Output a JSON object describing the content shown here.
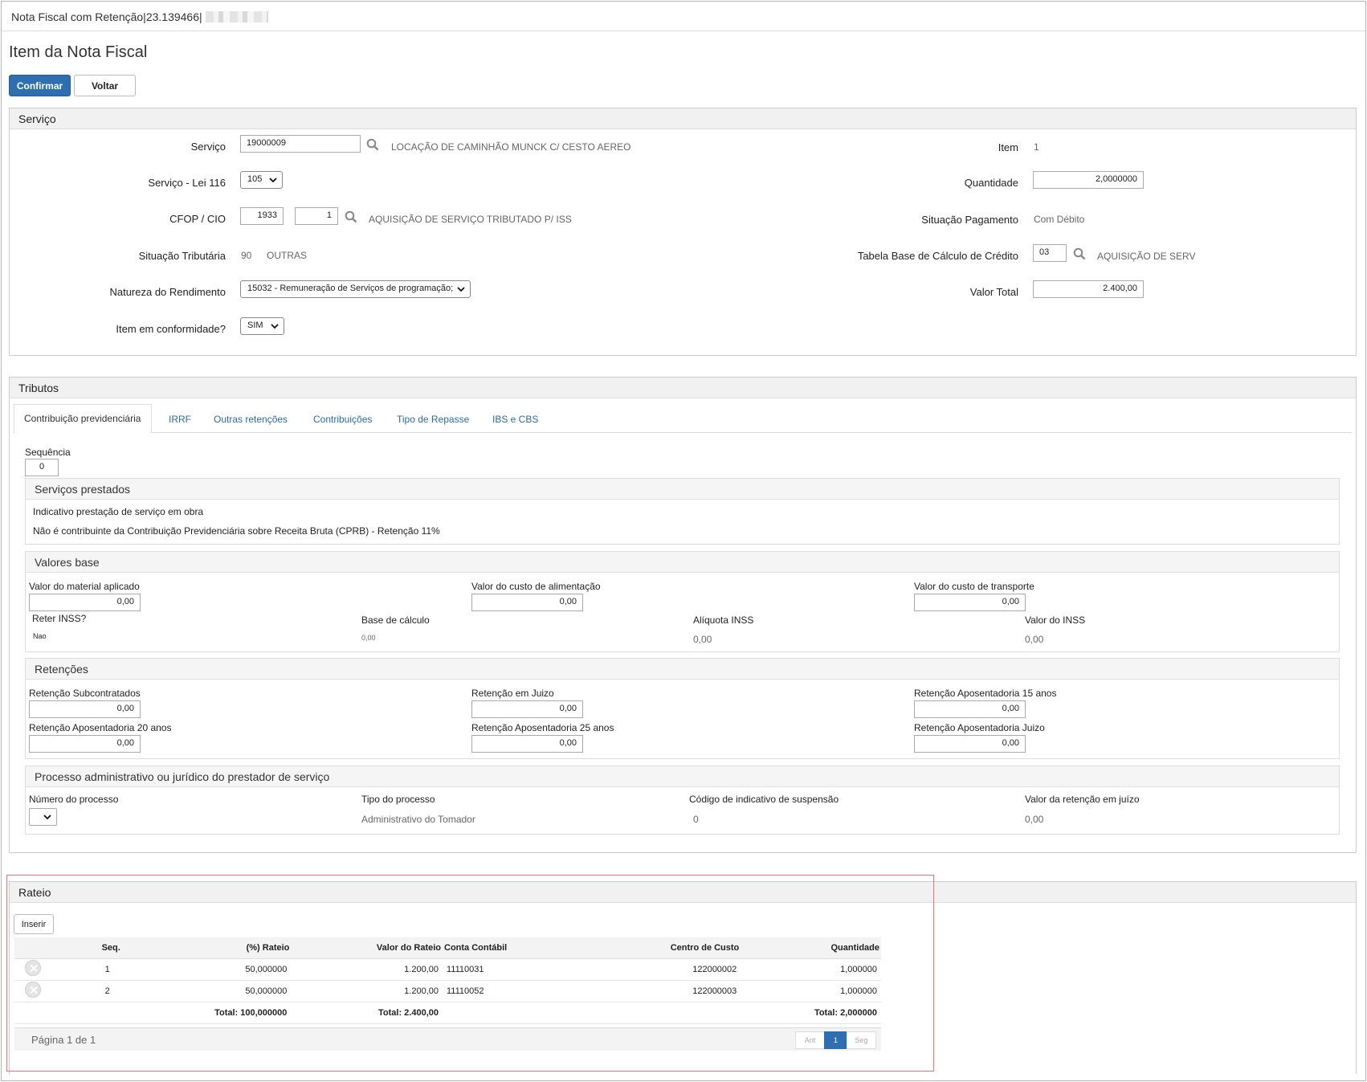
{
  "window_title": "Nota Fiscal com Retenção|23.139466|",
  "page_title": "Item da Nota Fiscal",
  "buttons": {
    "confirm": "Confirmar",
    "back": "Voltar"
  },
  "servico": {
    "header": "Serviço",
    "servico_label": "Serviço",
    "servico_code": "19000009",
    "servico_desc": "LOCAÇÃO DE CAMINHÃO MUNCK C/ CESTO AEREO",
    "lei116_label": "Serviço - Lei 116",
    "lei116_value": "105",
    "cfop_label": "CFOP / CIO",
    "cfop_value": "1933",
    "cio_value": "1",
    "cfop_desc": "AQUISIÇÃO DE SERVIÇO TRIBUTADO P/ ISS",
    "sit_trib_label": "Situação Tributária",
    "sit_trib_code": "90",
    "sit_trib_desc": "OUTRAS",
    "natureza_label": "Natureza do Rendimento",
    "natureza_value": "15032 - Remuneração de Serviços de programação;",
    "conformidade_label": "Item em conformidade?",
    "conformidade_value": "SIM",
    "item_label": "Item",
    "item_value": "1",
    "quantidade_label": "Quantidade",
    "quantidade_value": "2,0000000",
    "sit_pag_label": "Situação Pagamento",
    "sit_pag_value": "Com Débito",
    "tabela_label": "Tabela Base de Cálculo de Crédito",
    "tabela_value": "03",
    "tabela_desc": "AQUISIÇÃO DE SERV",
    "valor_total_label": "Valor Total",
    "valor_total_value": "2.400,00"
  },
  "tributos": {
    "header": "Tributos",
    "tabs": [
      "Contribuição previdenciária",
      "IRRF",
      "Outras retenções",
      "Contribuições",
      "Tipo de Repasse",
      "IBS e CBS"
    ],
    "sequencia_label": "Sequência",
    "sequencia_value": "0",
    "servicos_prestados": {
      "header": "Serviços prestados",
      "label": "Indicativo prestação de serviço em obra",
      "value": "Não é contribuinte da Contribuição Previdenciária sobre Receita Bruta (CPRB) - Retenção 11%"
    },
    "valores_base": {
      "header": "Valores base",
      "material_label": "Valor do material aplicado",
      "material_value": "0,00",
      "alimentacao_label": "Valor do custo de alimentação",
      "alimentacao_value": "0,00",
      "transporte_label": "Valor do custo de transporte",
      "transporte_value": "0,00",
      "reter_label": "Reter INSS?",
      "reter_value": "Nao",
      "base_label": "Base de cálculo",
      "base_value": "0,00",
      "aliquota_label": "Alíquota INSS",
      "aliquota_value": "0,00",
      "valor_inss_label": "Valor do INSS",
      "valor_inss_value": "0,00"
    },
    "retencoes": {
      "header": "Retenções",
      "subcontratados_label": "Retenção Subcontratados",
      "subcontratados_value": "0,00",
      "juizo_label": "Retenção em Juizo",
      "juizo_value": "0,00",
      "apos15_label": "Retenção Aposentadoria 15 anos",
      "apos15_value": "0,00",
      "apos20_label": "Retenção Aposentadoria 20 anos",
      "apos20_value": "0,00",
      "apos25_label": "Retenção Aposentadoria 25 anos",
      "apos25_value": "0,00",
      "apos_juizo_label": "Retenção Aposentadoria Juizo",
      "apos_juizo_value": "0,00"
    },
    "processo": {
      "header": "Processo administrativo ou jurídico do prestador de serviço",
      "numero_label": "Número do processo",
      "tipo_label": "Tipo do processo",
      "tipo_value": "Administrativo do Tomador",
      "codigo_label": "Código de indicativo de suspensão",
      "codigo_value": "0",
      "valor_label": "Valor da retenção em juízo",
      "valor_value": "0,00"
    }
  },
  "rateio": {
    "header": "Rateio",
    "insert_button": "Inserir",
    "columns": [
      "Seq.",
      "(%) Rateio",
      "Valor do Rateio",
      "Conta Contábil",
      "Centro de Custo",
      "Quantidade"
    ],
    "rows": [
      [
        "1",
        "50,000000",
        "1.200,00",
        "11110031",
        "122000002",
        "1,000000"
      ],
      [
        "2",
        "50,000000",
        "1.200,00",
        "11110052",
        "122000003",
        "1,000000"
      ]
    ],
    "totals": {
      "rateio": "Total: 100,000000",
      "valor": "Total: 2.400,00",
      "quantidade": "Total: 2,000000"
    },
    "pager": {
      "info": "Página 1 de 1",
      "prev": "Ant",
      "current": "1",
      "next": "Seg"
    }
  },
  "colors": {
    "primary": "#2e6fb2",
    "link": "#2a6ab0",
    "highlight_border": "#e8747c"
  }
}
